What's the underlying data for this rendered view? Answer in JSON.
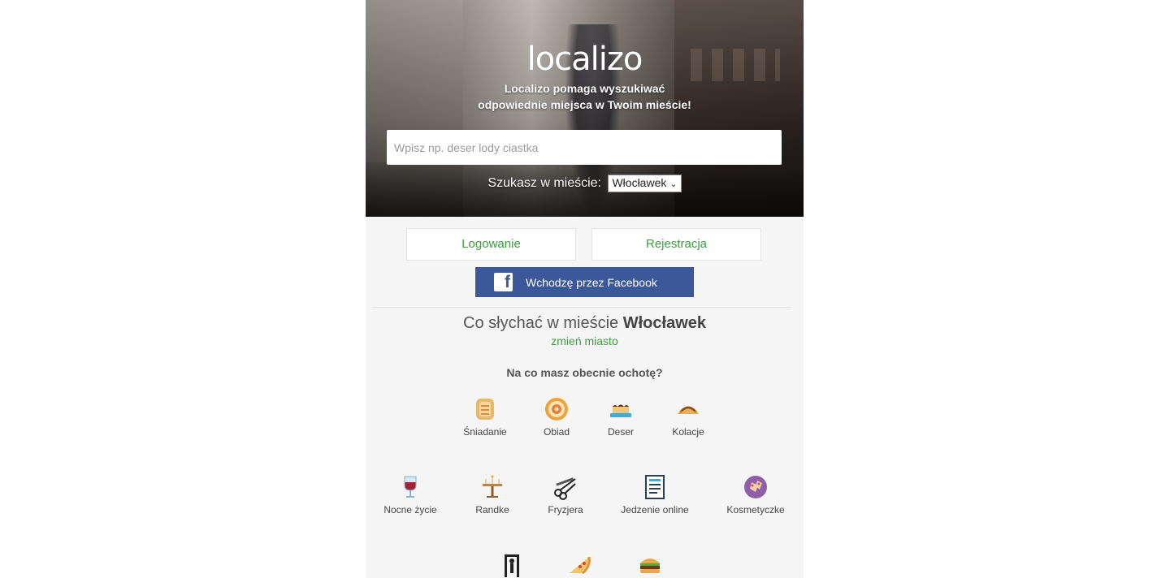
{
  "hero": {
    "logo": "localizo",
    "tagline_line1": "Localizo pomaga wyszukiwać",
    "tagline_line2": "odpowiednie miejsca w Twoim mieście!",
    "search_placeholder": "Wpisz np. deser lody ciastka",
    "city_label": "Szukasz w mieście:",
    "city_selected": "Włocławek"
  },
  "auth": {
    "login_label": "Logowanie",
    "register_label": "Rejestracja",
    "facebook_label": "Wchodzę przez Facebook"
  },
  "city_section": {
    "heading_prefix": "Co słychać w mieście",
    "city_name": "Włocławek",
    "change_city_label": "zmień miasto",
    "question": "Na co masz obecnie ochotę?"
  },
  "categories_row1": [
    {
      "label": "Śniadanie",
      "icon": "toast-icon"
    },
    {
      "label": "Obiad",
      "icon": "donut-plate-icon"
    },
    {
      "label": "Deser",
      "icon": "cake-icon"
    },
    {
      "label": "Kolacje",
      "icon": "taco-icon"
    }
  ],
  "categories_row2": [
    {
      "label": "Nocne życie",
      "icon": "wine-glass-icon"
    },
    {
      "label": "Randke",
      "icon": "table-icon"
    },
    {
      "label": "Fryzjera",
      "icon": "scissors-comb-icon"
    },
    {
      "label": "Jedzenie online",
      "icon": "menu-document-icon"
    },
    {
      "label": "Kosmetyczke",
      "icon": "nail-polish-icon"
    }
  ],
  "categories_row3": [
    {
      "icon": "gym-icon"
    },
    {
      "icon": "pizza-icon"
    },
    {
      "icon": "burger-icon"
    }
  ],
  "colors": {
    "accent_green": "#3d9c3f",
    "facebook_blue": "#3b5998",
    "page_bg": "#f5f5f5"
  }
}
